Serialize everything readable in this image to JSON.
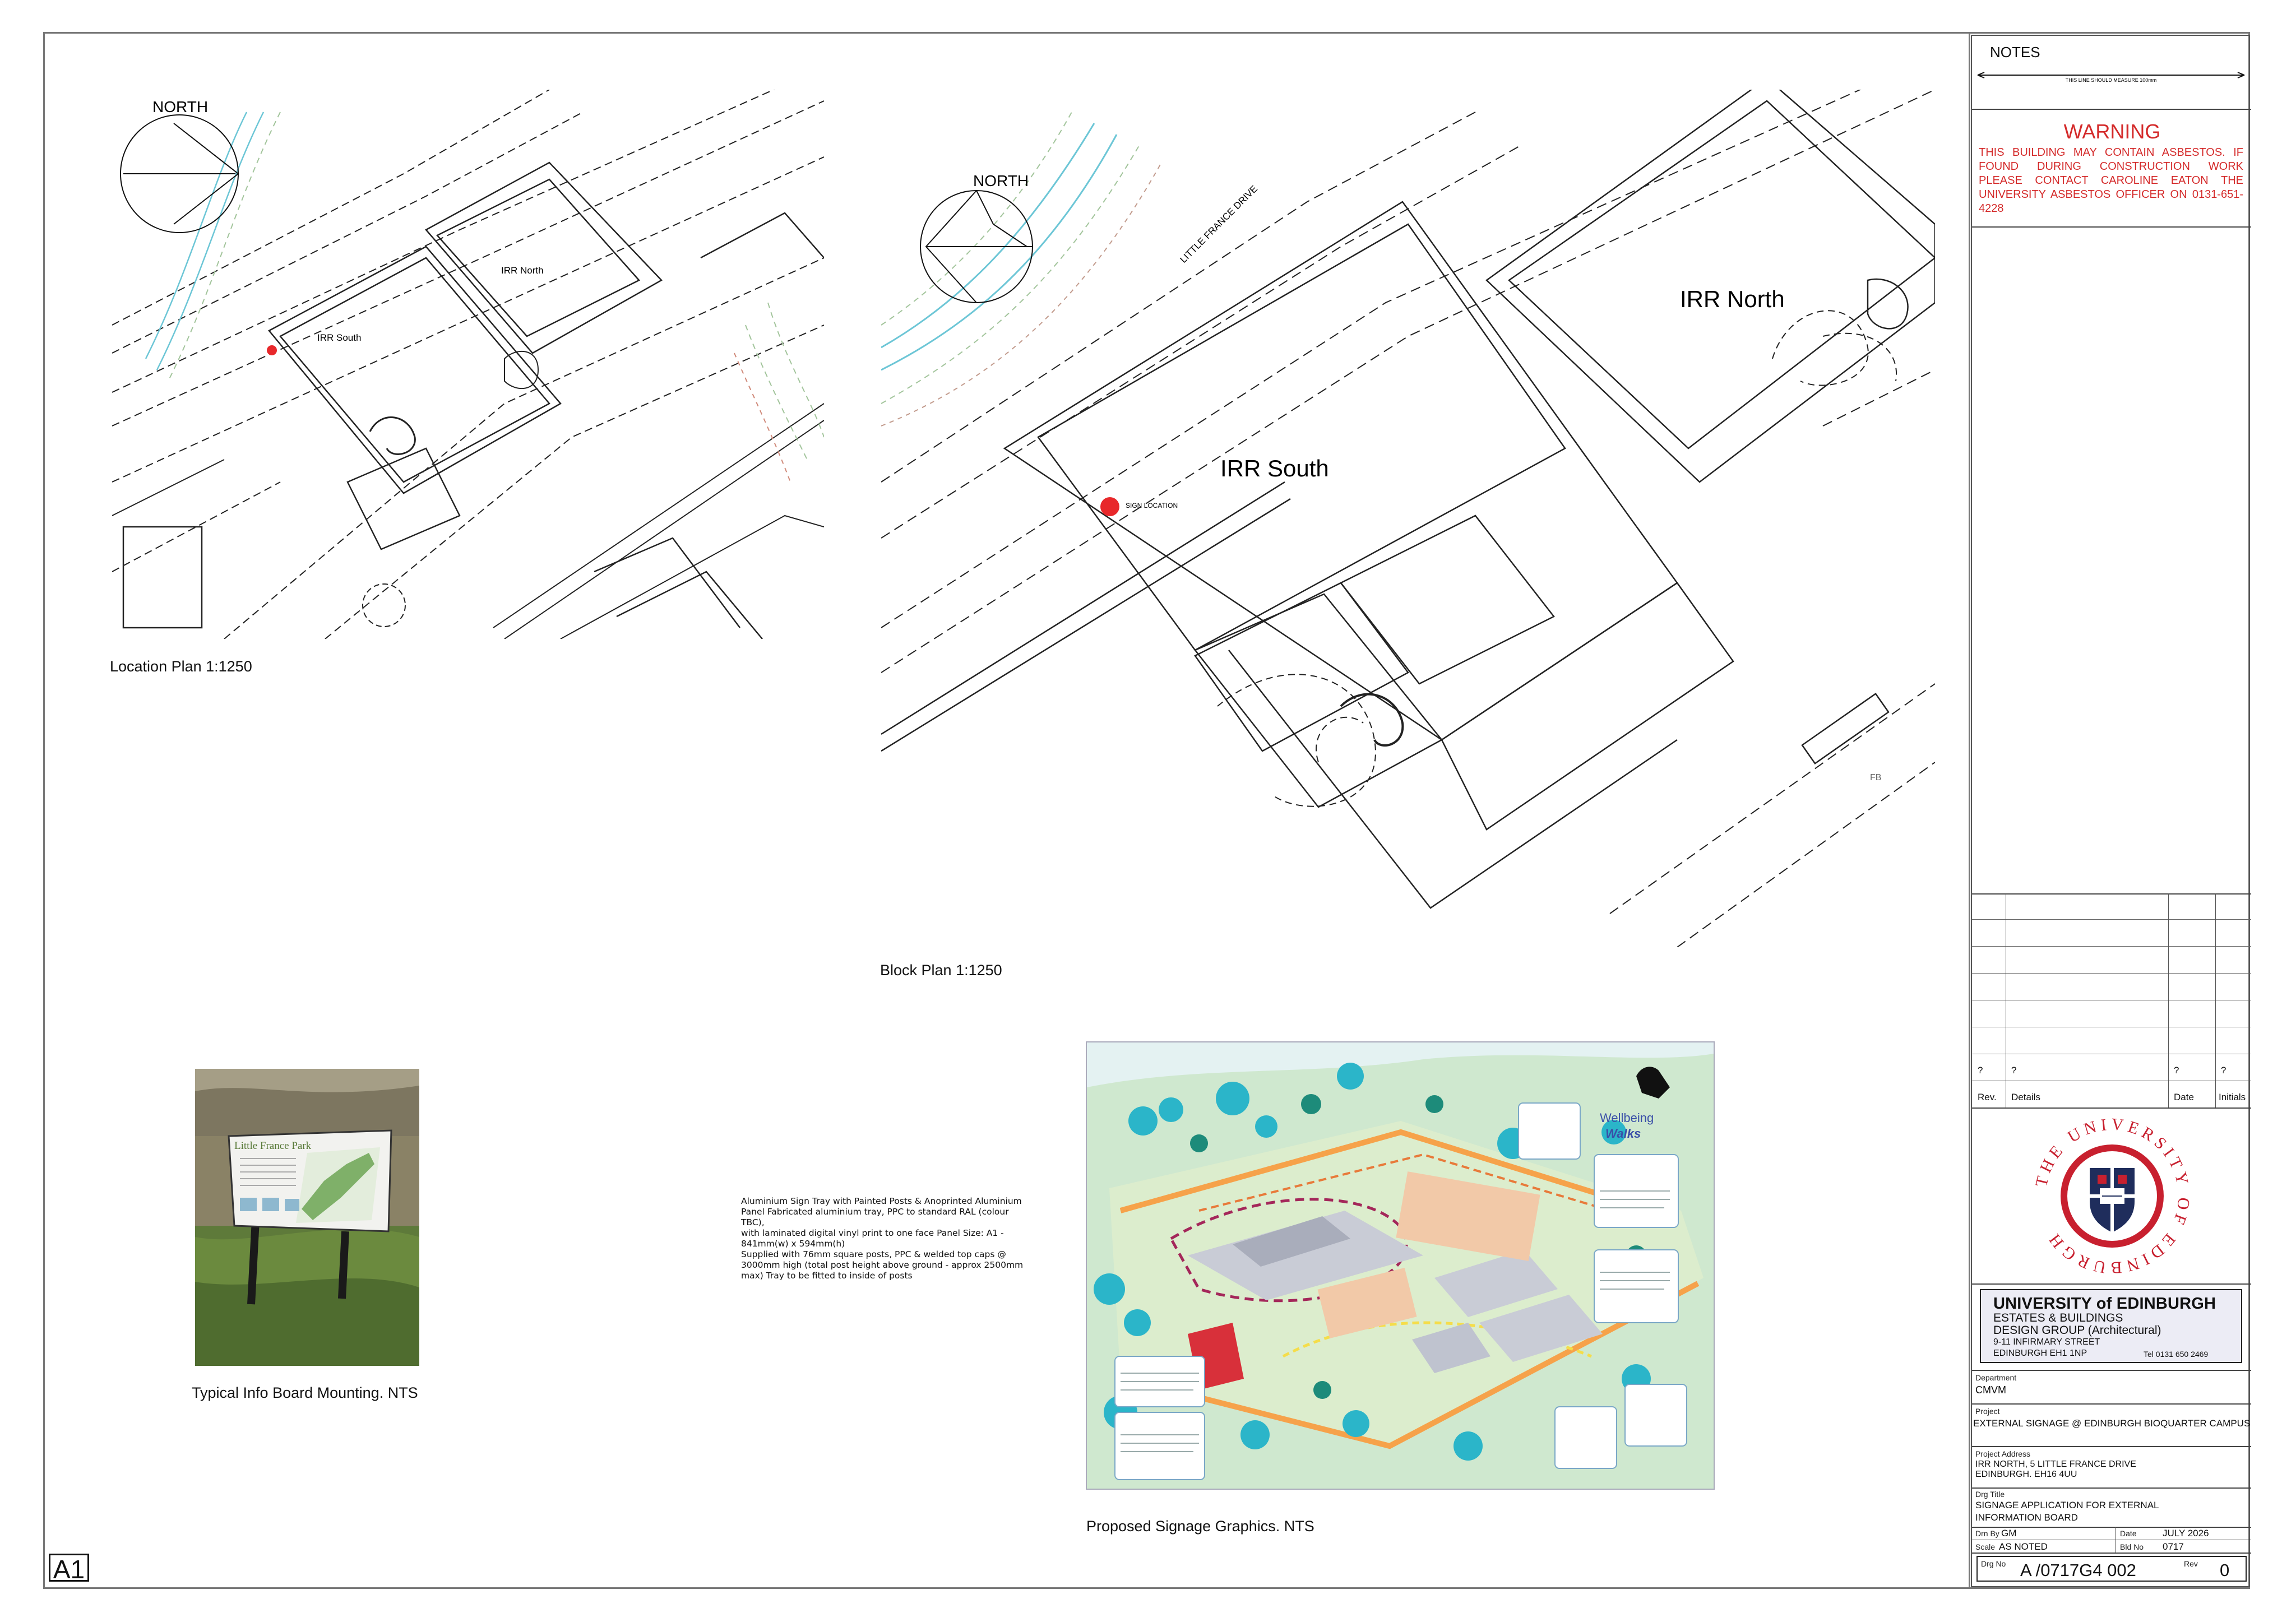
{
  "location_plan": {
    "north_label": "NORTH",
    "building_1": "IRR North",
    "building_2": "IRR South",
    "caption": "Location Plan 1:1250"
  },
  "block_plan": {
    "north_label": "NORTH",
    "road_label": "LITTLE FRANCE DRIVE",
    "building_1": "IRR North",
    "building_2": "IRR South",
    "sign_label": "SIGN LOCATION",
    "marker_fb": "FB",
    "caption": "Block Plan 1:1250"
  },
  "photo": {
    "caption": "Typical Info Board Mounting. NTS",
    "board_title": "Little France Park"
  },
  "spec": {
    "lines": [
      "Aluminium Sign Tray with Painted Posts & Anoprinted Aluminium",
      "Panel Fabricated aluminium tray, PPC to standard RAL (colour TBC),",
      "with laminated digital vinyl print to one face Panel Size: A1 -",
      "841mm(w) x 594mm(h)",
      "Supplied with 76mm square posts, PPC & welded top caps @",
      "3000mm high (total post height above ground - approx 2500mm",
      "max) Tray to be fitted to inside of posts"
    ]
  },
  "signage": {
    "caption": "Proposed Signage Graphics. NTS",
    "title_1": "Wellbeing",
    "title_2": "Walks"
  },
  "sheet": {
    "size": "A1"
  },
  "title_block": {
    "notes": "NOTES",
    "measure_note": "THIS LINE SHOULD MEASURE 100mm",
    "warning_title": "WARNING",
    "warning_body": "THIS BUILDING MAY CONTAIN ASBESTOS. IF FOUND DURING CONSTRUCTION WORK PLEASE CONTACT CAROLINE EATON THE UNIVERSITY ASBESTOS OFFICER ON 0131-651-4228",
    "rev_placeholders": [
      "?",
      "?",
      "?",
      "?"
    ],
    "rev_headers": [
      "Rev.",
      "Details",
      "Date",
      "Initials"
    ],
    "crest_text": "THE UNIVERSITY OF EDINBURGH",
    "org": {
      "name": "UNIVERSITY of EDINBURGH",
      "line2": "ESTATES & BUILDINGS",
      "line3": "DESIGN GROUP (Architectural)",
      "line4": "9-11 INFIRMARY STREET",
      "line5": "EDINBURGH EH1 1NP",
      "tel": "Tel 0131 650 2469"
    },
    "department_label": "Department",
    "department": "CMVM",
    "project_label": "Project",
    "project": "EXTERNAL SIGNAGE @ EDINBURGH BIOQUARTER CAMPUS",
    "address_label": "Project Address",
    "address_1": "IRR NORTH, 5 LITTLE FRANCE DRIVE",
    "address_2": "EDINBURGH. EH16 4UU",
    "drg_title_label": "Drg Title",
    "drg_title_1": "SIGNAGE APPLICATION FOR EXTERNAL",
    "drg_title_2": "INFORMATION BOARD",
    "drn_by_label": "Drn By",
    "drn_by": "GM",
    "date_label": "Date",
    "date": "JULY 2026",
    "scale_label": "Scale",
    "scale": "AS NOTED",
    "bld_no_label": "Bld No",
    "bld_no": "0717",
    "drg_no_label": "Drg No",
    "drg_no": "A /0717G4 002",
    "rev_label": "Rev",
    "rev": "0"
  },
  "colors": {
    "warning": "#d42a2a",
    "sign_marker": "#e8282b",
    "crest_red": "#c8202f",
    "crest_navy": "#1f2d5c",
    "title_block_fill": "#ececf5"
  }
}
